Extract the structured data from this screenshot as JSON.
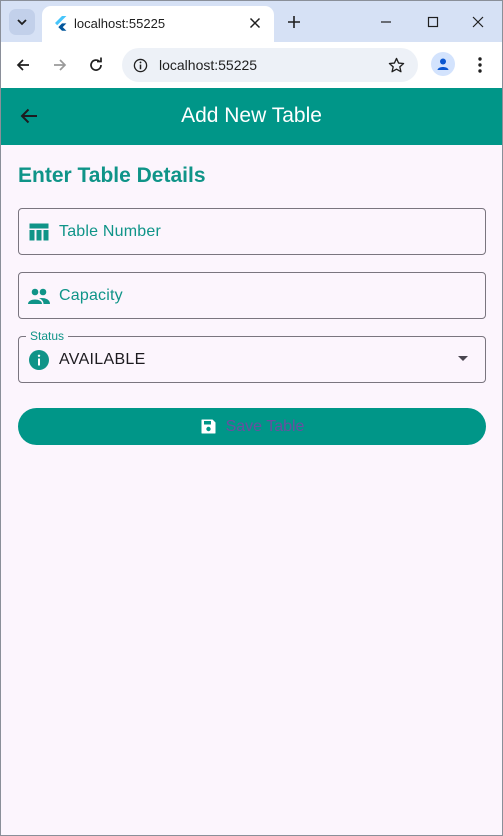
{
  "browser": {
    "tab_title": "localhost:55225",
    "url": "localhost:55225"
  },
  "app": {
    "title": "Add New Table",
    "section_title": "Enter Table Details",
    "fields": {
      "table_number": {
        "label": "Table Number",
        "icon": "table-icon"
      },
      "capacity": {
        "label": "Capacity",
        "icon": "people-icon"
      },
      "status": {
        "label": "Status",
        "value": "AVAILABLE",
        "icon": "info-icon"
      }
    },
    "save_button": {
      "label": "Save Table",
      "icon": "save-icon"
    },
    "colors": {
      "primary": "#009688",
      "label": "#0f9488",
      "background": "#fcf5fd"
    }
  }
}
